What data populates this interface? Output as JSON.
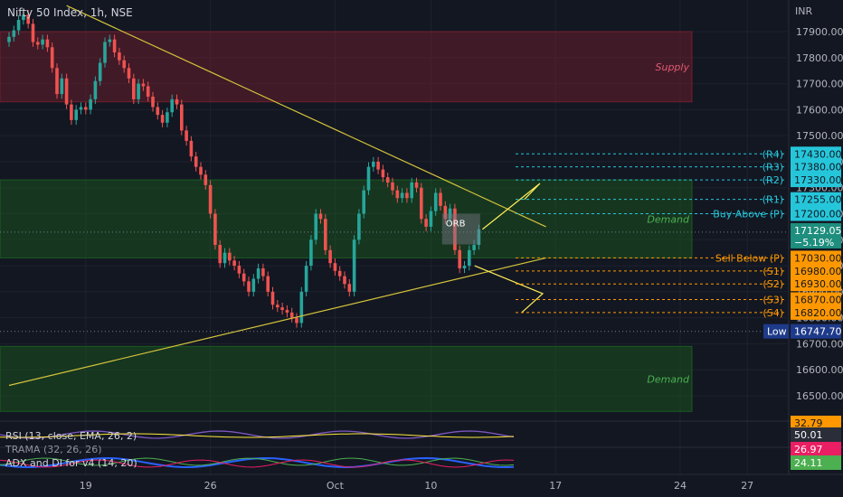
{
  "header": {
    "symbol_title": "Nifty 50 Index, 1h, NSE",
    "currency": "INR"
  },
  "colors": {
    "up": "#26a69a",
    "down": "#ef5350",
    "supply": "#7a1f2e",
    "demand": "#1b5e20",
    "trendline": "#d4c33a",
    "level_above": "#26c6da",
    "level_below": "#ff9800",
    "rsi": "#7e57c2",
    "rsi_ema": "#ffeb3b",
    "adx": "#2962ff",
    "di_plus": "#4caf50",
    "di_minus": "#e91e63"
  },
  "zones": [
    {
      "label": "Supply",
      "kind": "supply",
      "from": 17630,
      "to": 17900
    },
    {
      "label": "Demand",
      "kind": "demand",
      "from": 17030,
      "to": 17330
    },
    {
      "label": "Demand",
      "kind": "demand",
      "from": 16440,
      "to": 16690
    }
  ],
  "orb_label": "ORB",
  "levels": [
    {
      "label": "(R4)",
      "value": 17430,
      "price_label": "17430.00",
      "side": "above"
    },
    {
      "label": "(R3)",
      "value": 17380,
      "price_label": "17380.00",
      "side": "above"
    },
    {
      "label": "(R2)",
      "value": 17330,
      "price_label": "17330.00",
      "side": "above"
    },
    {
      "label": "(R1)",
      "value": 17255,
      "price_label": "17255.00",
      "side": "above"
    },
    {
      "label": "Buy Above (P)",
      "value": 17200,
      "price_label": "17200.00",
      "side": "above"
    },
    {
      "label": "Sell Below (P)",
      "value": 17030,
      "price_label": "17030.00",
      "side": "below"
    },
    {
      "label": "(S1)",
      "value": 16980,
      "price_label": "16980.00",
      "side": "below"
    },
    {
      "label": "(S2)",
      "value": 16930,
      "price_label": "16930.00",
      "side": "below"
    },
    {
      "label": "(S3)",
      "value": 16870,
      "price_label": "16870.00",
      "side": "below"
    },
    {
      "label": "(S4)",
      "value": 16820,
      "price_label": "16820.00",
      "side": "below"
    }
  ],
  "last_price": {
    "value": 17129.05,
    "price_label": "17129.05",
    "change": "−5.19%"
  },
  "low_marker": {
    "label": "Low",
    "value": 16747.7,
    "price_label": "16747.70"
  },
  "indicators": {
    "rsi": {
      "label": "RSI (13, close, EMA, 26, 2)",
      "values": [
        "32.79",
        "50.01"
      ]
    },
    "trama": {
      "label": "TRAMA (32, 26, 26)",
      "values": [
        "26.97"
      ]
    },
    "adx": {
      "label": "ADX and DI for v4 (14, 20)",
      "values": [
        "24.11"
      ]
    }
  },
  "chart_data": {
    "type": "candlestick",
    "title": "Nifty 50 Index, 1h, NSE",
    "xlabel": "",
    "ylabel": "",
    "ylim": [
      16420,
      18000
    ],
    "y_ticks": [
      16500,
      16600,
      16700,
      16800,
      16900,
      17000,
      17100,
      17200,
      17300,
      17400,
      17500,
      17600,
      17700,
      17800,
      17900
    ],
    "y_tick_labels": [
      "16500.00",
      "16600.00",
      "16700.00",
      "16800.00",
      "16900.00",
      "17000.00",
      "17100.00",
      "17200.00",
      "17300.00",
      "17400.00",
      "17500.00",
      "17600.00",
      "17700.00",
      "17800.00",
      "17900.00"
    ],
    "x_tick_labels": [
      "19",
      "26",
      "Oct",
      "10",
      "17",
      "24",
      "27"
    ],
    "x_tick_index": [
      16,
      42,
      68,
      88,
      114,
      140,
      154
    ],
    "candles_start_index": 0,
    "candles_close": [
      17880,
      17905,
      17945,
      17965,
      17930,
      17860,
      17850,
      17870,
      17840,
      17760,
      17660,
      17720,
      17620,
      17560,
      17600,
      17610,
      17600,
      17640,
      17710,
      17780,
      17860,
      17870,
      17820,
      17790,
      17760,
      17720,
      17640,
      17700,
      17690,
      17650,
      17610,
      17580,
      17550,
      17590,
      17640,
      17620,
      17520,
      17480,
      17420,
      17380,
      17350,
      17310,
      17200,
      17080,
      17010,
      17050,
      17020,
      17000,
      16970,
      16940,
      16900,
      16950,
      16990,
      16960,
      16900,
      16850,
      16840,
      16830,
      16820,
      16800,
      16780,
      16900,
      17000,
      17100,
      17200,
      17180,
      17060,
      17010,
      16980,
      16960,
      16930,
      16900,
      17100,
      17200,
      17290,
      17380,
      17400,
      17370,
      17340,
      17320,
      17290,
      17260,
      17280,
      17260,
      17320,
      17300,
      17180,
      17150,
      17210,
      17280,
      17230,
      17180,
      17220,
      17060,
      16990,
      17000,
      17060,
      17080,
      17140
    ],
    "trendlines": [
      {
        "name": "upper",
        "points": [
          [
            12,
            18000
          ],
          [
            112,
            17150
          ]
        ]
      },
      {
        "name": "lower",
        "points": [
          [
            0,
            16540
          ],
          [
            112,
            17030
          ]
        ]
      }
    ]
  }
}
